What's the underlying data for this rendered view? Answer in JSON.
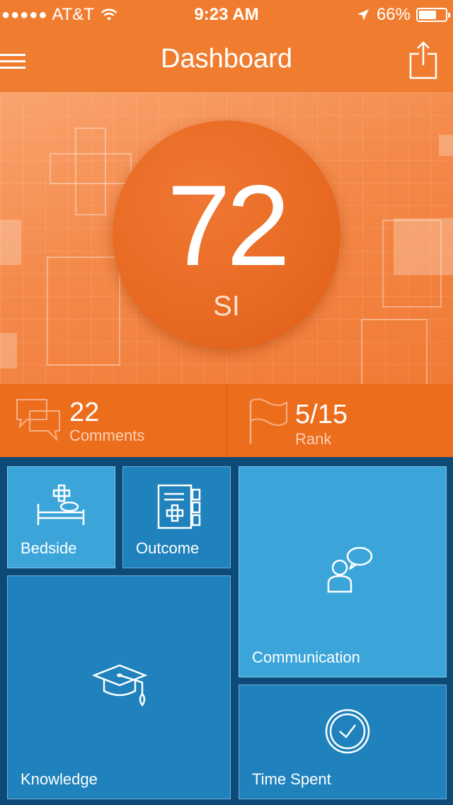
{
  "status_bar": {
    "signal": "●●●●●",
    "carrier": "AT&T",
    "time": "9:23 AM",
    "battery_percent": "66%",
    "battery_level": 0.66
  },
  "nav": {
    "title": "Dashboard",
    "menu_icon": "hamburger-menu-icon",
    "share_icon": "share-icon"
  },
  "hero": {
    "score": "72",
    "unit": "SI"
  },
  "stats": {
    "comments": {
      "value": "22",
      "label": "Comments",
      "icon": "chat-bubbles-icon"
    },
    "rank": {
      "value": "5/15",
      "label": "Rank",
      "icon": "flag-icon"
    }
  },
  "tiles": [
    {
      "label": "Bedside",
      "icon": "hospital-bed-icon"
    },
    {
      "label": "Outcome",
      "icon": "medical-chart-icon"
    },
    {
      "label": "Communication",
      "icon": "person-speech-icon"
    },
    {
      "label": "Knowledge",
      "icon": "graduation-cap-icon"
    },
    {
      "label": "Time Spent",
      "icon": "clock-icon"
    }
  ],
  "colors": {
    "accent_orange": "#f07d2f",
    "tile_light_blue": "#3ba5da",
    "tile_dark_blue": "#1f82bd",
    "background_navy": "#0e4a78"
  }
}
